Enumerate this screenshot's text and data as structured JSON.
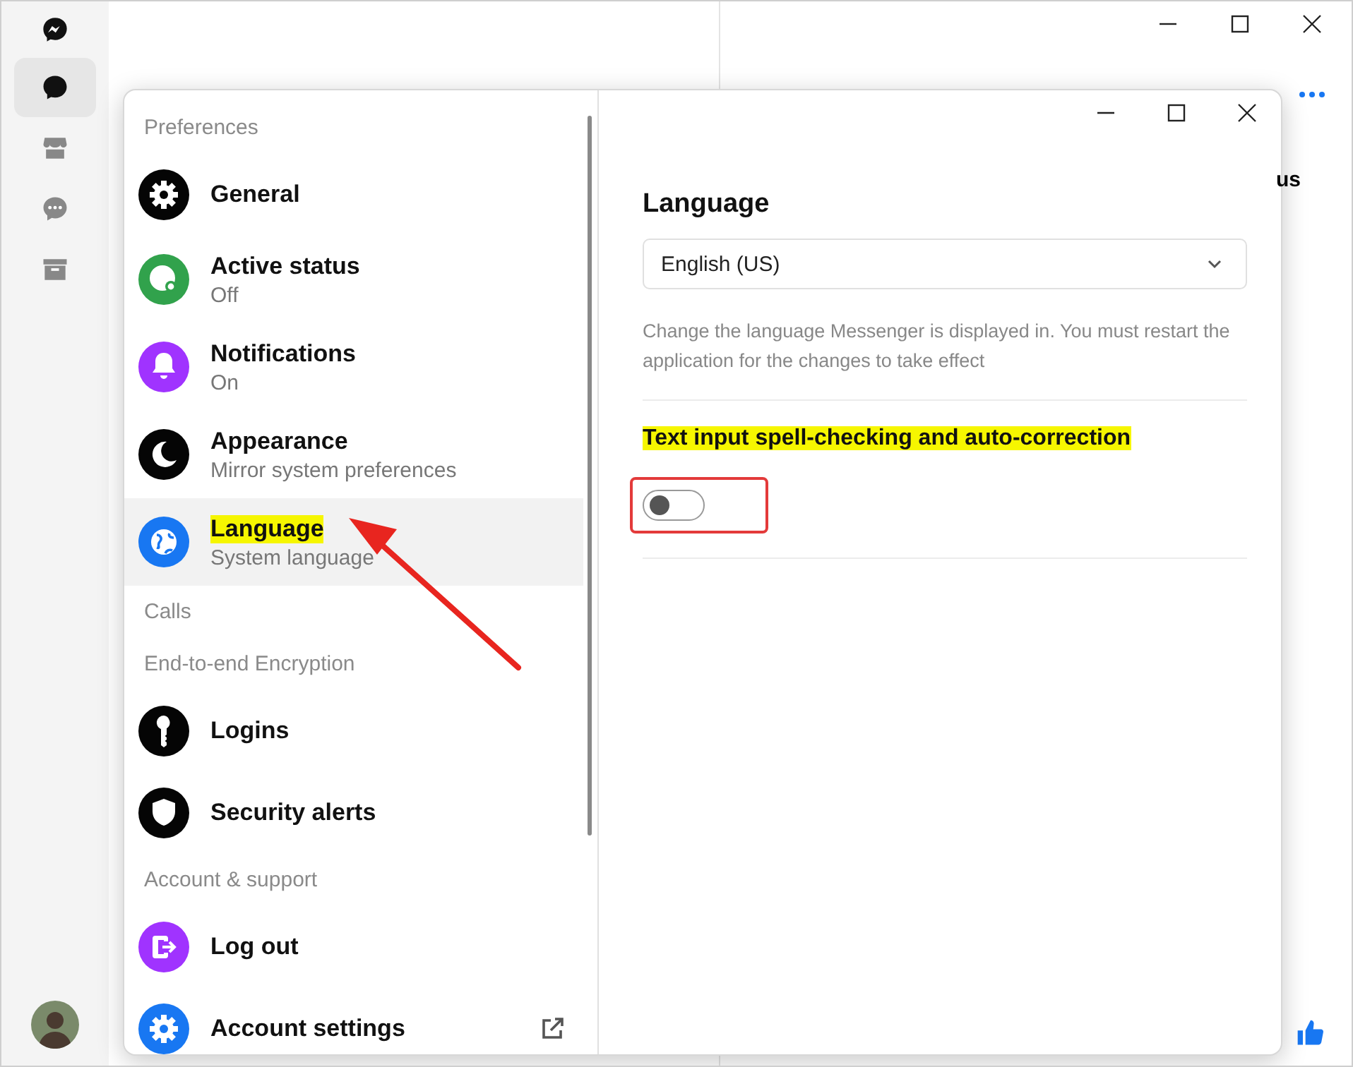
{
  "rail": [
    {
      "selected": true
    },
    {
      "selected": false
    },
    {
      "selected": false
    },
    {
      "selected": false
    }
  ],
  "conversation": {
    "fragment": "us"
  },
  "settings": {
    "items": [
      {
        "kind": "section",
        "label": "Preferences"
      },
      {
        "kind": "item",
        "label": "General",
        "color": "#050505",
        "selected": false,
        "highlighted": false
      },
      {
        "kind": "item",
        "label": "Active status",
        "sub": "Off",
        "color": "#31a24c",
        "selected": false,
        "highlighted": false
      },
      {
        "kind": "item",
        "label": "Notifications",
        "sub": "On",
        "color": "#a033ff",
        "selected": false,
        "highlighted": false
      },
      {
        "kind": "item",
        "label": "Appearance",
        "sub": "Mirror system preferences",
        "color": "#050505",
        "selected": false,
        "highlighted": false
      },
      {
        "kind": "item",
        "label": "Language",
        "sub": "System language",
        "color": "#1877f2",
        "selected": true,
        "highlighted": true
      },
      {
        "kind": "section",
        "label": "Calls"
      },
      {
        "kind": "section",
        "label": "End-to-end Encryption"
      },
      {
        "kind": "item",
        "label": "Logins",
        "color": "#050505",
        "selected": false,
        "highlighted": false
      },
      {
        "kind": "item",
        "label": "Security alerts",
        "color": "#050505",
        "selected": false,
        "highlighted": false
      },
      {
        "kind": "section",
        "label": "Account & support"
      },
      {
        "kind": "item",
        "label": "Log out",
        "color": "#a033ff",
        "selected": false,
        "highlighted": false
      },
      {
        "kind": "item",
        "label": "Account settings",
        "color": "#1877f2",
        "selected": false,
        "highlighted": false,
        "external": true
      }
    ]
  },
  "language": {
    "heading": "Language",
    "value": "English (US)",
    "description": "Change the language Messenger is displayed in. You must restart the application for the changes to take effect",
    "spell_title": "Text input spell-checking and auto-correction",
    "spell_highlighted": true,
    "toggle": {
      "on": false,
      "annotated": true
    }
  },
  "annotations": [
    {
      "kind": "arrow"
    }
  ]
}
